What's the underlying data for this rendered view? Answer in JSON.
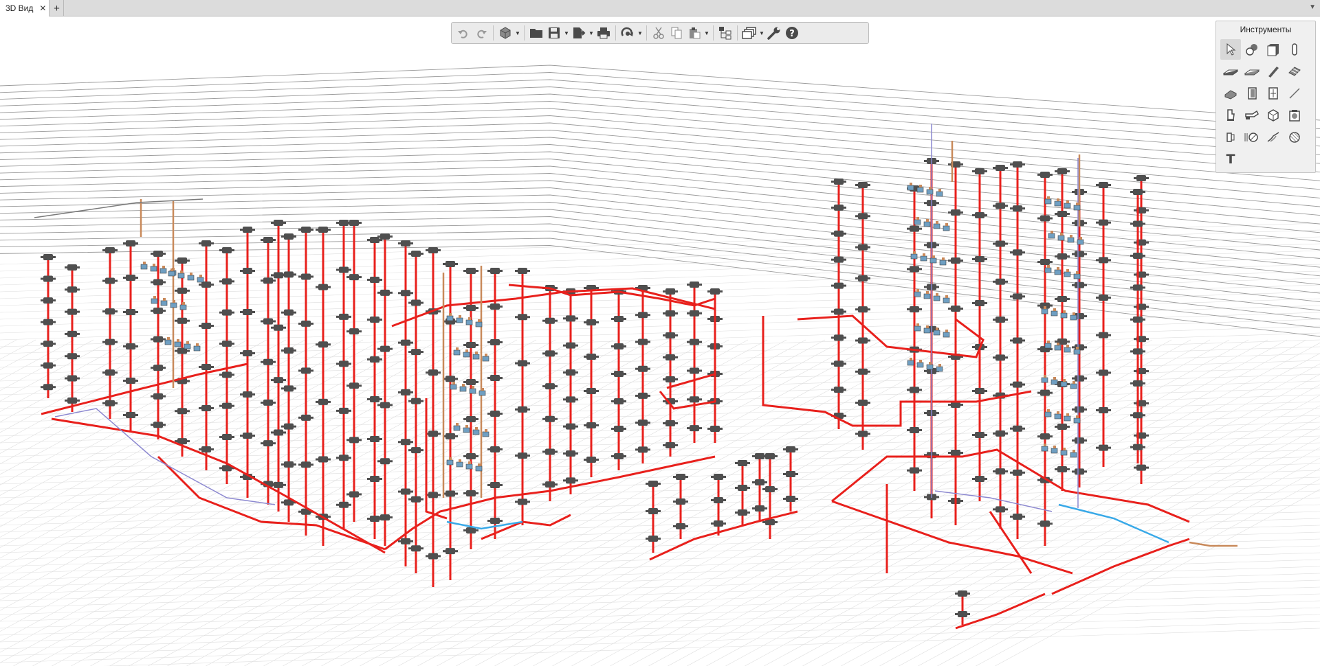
{
  "tabs": [
    {
      "label": "3D Вид",
      "active": true
    }
  ],
  "toolbar": {
    "buttons": [
      {
        "id": "undo",
        "icon": "undo-icon"
      },
      {
        "id": "redo",
        "icon": "redo-icon"
      },
      {
        "id": "view-3d",
        "icon": "cube-icon",
        "dropdown": true
      },
      {
        "id": "open",
        "icon": "folder-icon"
      },
      {
        "id": "save",
        "icon": "save-icon",
        "dropdown": true
      },
      {
        "id": "export",
        "icon": "export-icon",
        "dropdown": true
      },
      {
        "id": "print",
        "icon": "printer-icon"
      },
      {
        "id": "sync",
        "icon": "sync-icon",
        "dropdown": true
      },
      {
        "id": "cut",
        "icon": "scissors-icon"
      },
      {
        "id": "copy",
        "icon": "copy-icon"
      },
      {
        "id": "paste",
        "icon": "paste-icon",
        "dropdown": true
      },
      {
        "id": "structure",
        "icon": "structure-icon"
      },
      {
        "id": "layers",
        "icon": "layers-icon",
        "dropdown": true
      },
      {
        "id": "settings",
        "icon": "wrench-icon"
      },
      {
        "id": "help",
        "icon": "help-icon"
      }
    ]
  },
  "tools_panel": {
    "title": "Инструменты",
    "tools": [
      "pointer-icon",
      "shapes-icon",
      "wall-icon",
      "column-icon",
      "slab-icon",
      "floor-icon",
      "beam-icon",
      "stair-icon",
      "roof-icon",
      "door-icon",
      "window-icon",
      "line-icon",
      "sanitary-icon",
      "pipe-fitting-icon",
      "solid-icon",
      "equipment-icon",
      "opening-icon",
      "valve-icon",
      "duct-icon",
      "hatch-icon",
      "text-icon"
    ]
  },
  "colors": {
    "pipe_red": "#e8201c",
    "pipe_blue": "#38a9e8",
    "pipe_brown": "#c8895a",
    "fitting_gray": "#4f4f4f",
    "grid": "#dedede",
    "wall_line": "#9a9a9a"
  }
}
